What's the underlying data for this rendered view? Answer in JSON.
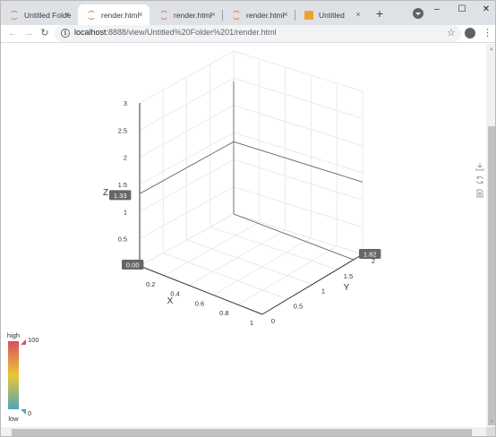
{
  "browser": {
    "tabs": [
      {
        "title": "Untitled Folder",
        "icon": "jupyter-icon",
        "active": false
      },
      {
        "title": "render.html",
        "icon": "jupyter-icon",
        "active": true
      },
      {
        "title": "render.html",
        "icon": "jupyter-icon",
        "active": false
      },
      {
        "title": "render.html",
        "icon": "jupyter-icon",
        "active": false
      },
      {
        "title": "Untitled",
        "icon": "document-icon",
        "active": false
      }
    ],
    "tab_close_glyph": "×",
    "new_tab_glyph": "+",
    "address": {
      "host": "localhost",
      "path": ":8888/view/Untitled%20Folder%201/render.html"
    },
    "controls": {
      "minimize": "–",
      "maximize": "☐",
      "close": "✕"
    }
  },
  "chart_data": {
    "type": "scatter3d",
    "xlabel": "X",
    "ylabel": "Y",
    "zlabel": "Z",
    "x_ticks": [
      "0.2",
      "0.4",
      "0.6",
      "0.8",
      "1"
    ],
    "y_ticks": [
      "0",
      "0.5",
      "1",
      "1.5",
      "2"
    ],
    "z_ticks": [
      "0.5",
      "1",
      "1.5",
      "2",
      "2.5",
      "3"
    ],
    "xlim": [
      0,
      1
    ],
    "ylim": [
      0,
      2
    ],
    "zlim": [
      0,
      3
    ],
    "grid": true,
    "hover_readouts": {
      "z": "1.33",
      "y": "1.82",
      "z_base": "0.00"
    },
    "visual_map": {
      "high_label": "high",
      "low_label": "low",
      "max": "100",
      "min": "0",
      "colors": [
        "#d94e5d",
        "#eac736",
        "#50a3ba"
      ]
    }
  }
}
